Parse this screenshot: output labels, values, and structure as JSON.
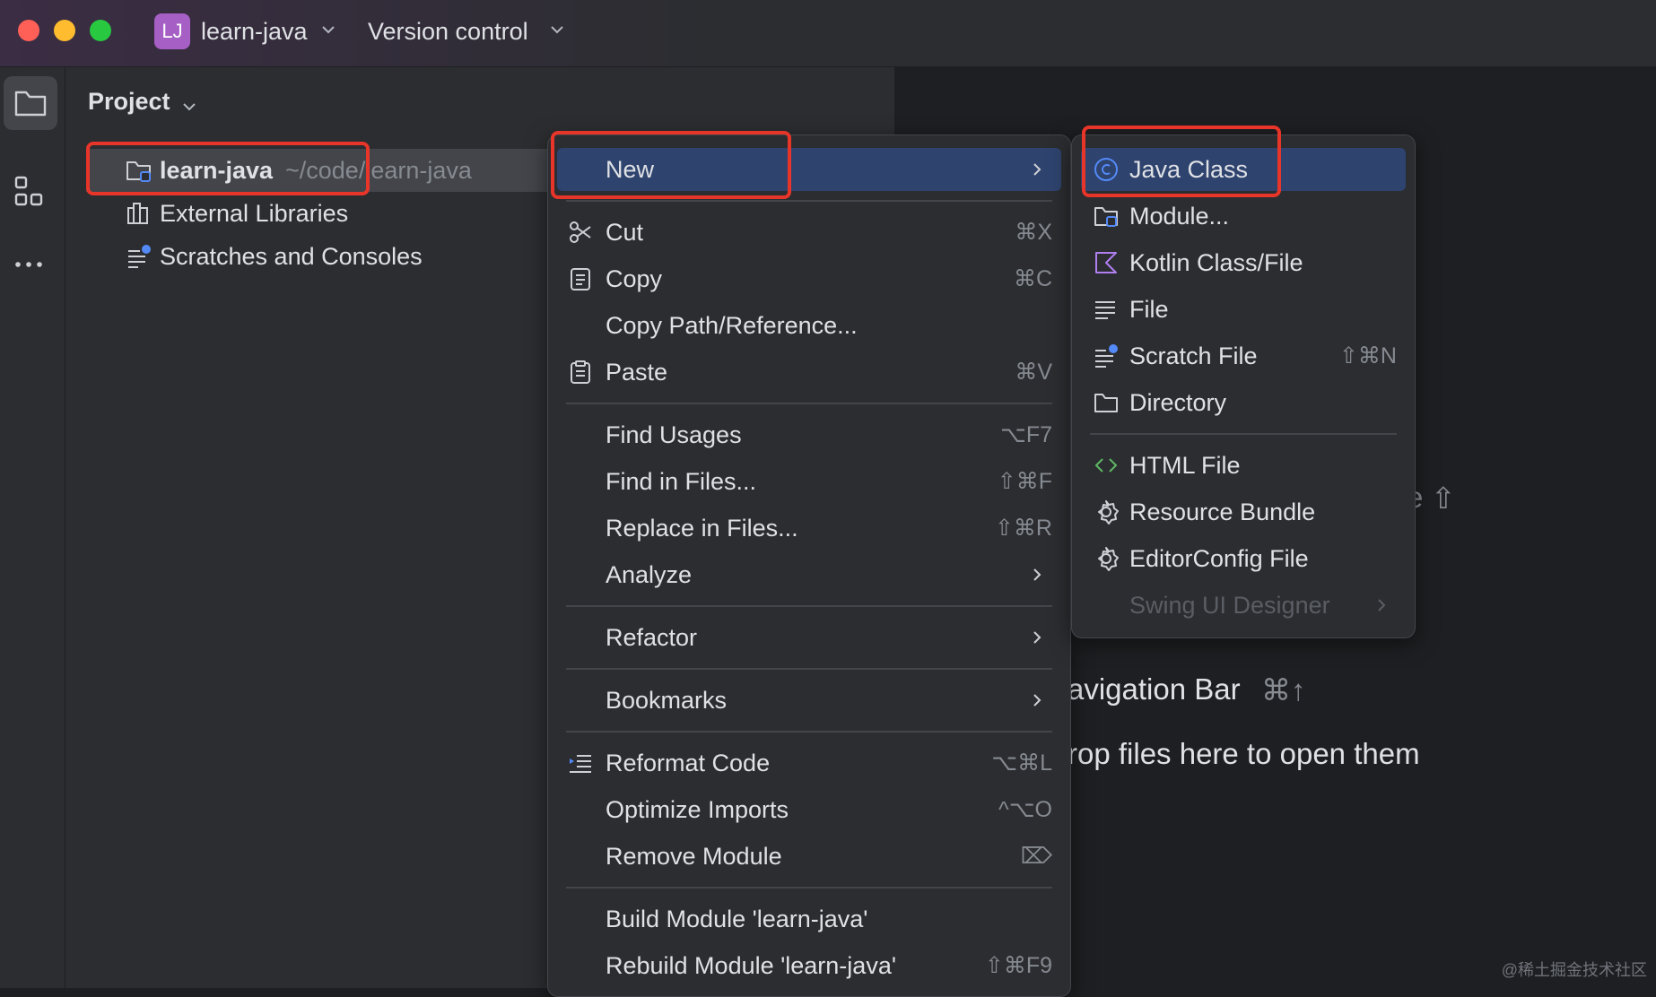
{
  "titlebar": {
    "project_badge": "LJ",
    "project_name": "learn-java",
    "vcs_label": "Version control",
    "colors": {
      "close": "#fe5f57",
      "minimize": "#febc2e",
      "zoom": "#28c840",
      "badge": "#a65fc4"
    }
  },
  "toolstrip": {
    "icons": [
      "folder-icon",
      "structure-icon",
      "more-icon"
    ]
  },
  "project_panel": {
    "title": "Project",
    "tree": [
      {
        "label": "learn-java",
        "path": "~/code/learn-java",
        "icon": "module-folder-icon"
      },
      {
        "label": "External Libraries",
        "icon": "libraries-icon"
      },
      {
        "label": "Scratches and Consoles",
        "icon": "scratches-icon"
      }
    ]
  },
  "context_menu": {
    "items": [
      {
        "label": "New",
        "submenu": true,
        "selected": true
      },
      {
        "label": "Cut",
        "shortcut": "⌘X",
        "icon": "scissors-icon"
      },
      {
        "label": "Copy",
        "shortcut": "⌘C",
        "icon": "copy-icon"
      },
      {
        "label": "Copy Path/Reference..."
      },
      {
        "label": "Paste",
        "shortcut": "⌘V",
        "icon": "paste-icon"
      },
      {
        "label": "Find Usages",
        "shortcut": "⌥F7"
      },
      {
        "label": "Find in Files...",
        "shortcut": "⇧⌘F"
      },
      {
        "label": "Replace in Files...",
        "shortcut": "⇧⌘R"
      },
      {
        "label": "Analyze",
        "submenu": true
      },
      {
        "label": "Refactor",
        "submenu": true
      },
      {
        "label": "Bookmarks",
        "submenu": true
      },
      {
        "label": "Reformat Code",
        "shortcut": "⌥⌘L",
        "icon": "reformat-icon"
      },
      {
        "label": "Optimize Imports",
        "shortcut": "^⌥O"
      },
      {
        "label": "Remove Module",
        "shortcut": "⌦"
      },
      {
        "label": "Build Module 'learn-java'"
      },
      {
        "label": "Rebuild Module 'learn-java'",
        "shortcut": "⇧⌘F9"
      }
    ]
  },
  "new_submenu": {
    "items": [
      {
        "label": "Java Class",
        "icon": "java-class-icon",
        "selected": true
      },
      {
        "label": "Module...",
        "icon": "module-icon"
      },
      {
        "label": "Kotlin Class/File",
        "icon": "kotlin-icon"
      },
      {
        "label": "File",
        "icon": "file-icon"
      },
      {
        "label": "Scratch File",
        "shortcut": "⇧⌘N",
        "icon": "scratch-file-icon"
      },
      {
        "label": "Directory",
        "icon": "directory-icon"
      },
      {
        "label": "HTML File",
        "icon": "html-icon"
      },
      {
        "label": "Resource Bundle",
        "icon": "resource-bundle-icon"
      },
      {
        "label": "EditorConfig File",
        "icon": "editorconfig-icon"
      },
      {
        "label": "Swing UI Designer",
        "submenu": true,
        "disabled": true
      }
    ]
  },
  "editor_hints": {
    "hint_fragment": "e",
    "hint_shortcut": "⇧",
    "nav_bar": "avigation Bar",
    "nav_bar_shortcut": "⌘↑",
    "drop_files": "rop files here to open them"
  },
  "watermark": "@稀土掘金技术社区"
}
